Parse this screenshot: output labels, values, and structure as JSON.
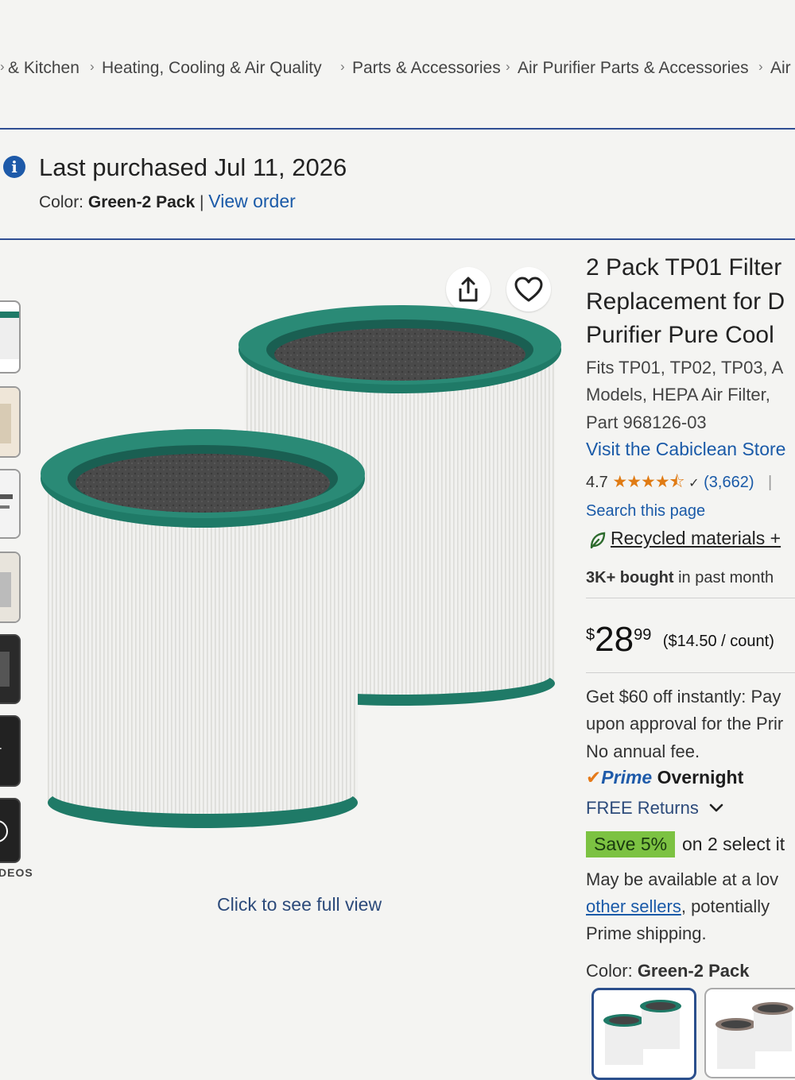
{
  "breadcrumb": [
    "& Kitchen",
    "Heating, Cooling & Air Quality",
    "Parts & Accessories",
    "Air Purifier Parts & Accessories",
    "Air"
  ],
  "last_purchased": {
    "title": "Last purchased Jul 11, 2026",
    "color_label": "Color:",
    "color_value": "Green-2 Pack",
    "separator": "|",
    "view_order": "View order"
  },
  "gallery": {
    "videos_label": "DEOS",
    "full_view": "Click to see full view"
  },
  "product": {
    "title_lines": [
      "2 Pack TP01 Filter",
      "Replacement for D",
      "Purifier Pure Cool"
    ],
    "subtitle_lines": [
      "Fits TP01, TP02, TP03, A",
      "Models, HEPA Air Filter,",
      "Part 968126-03"
    ],
    "store": "Visit the Cabiclean Store",
    "rating": "4.7",
    "stars": "★★★★⯪",
    "review_count": "(3,662)",
    "search_page": "Search this page",
    "recycled": "Recycled materials +",
    "bought_bold": "3K+ bought",
    "bought_rest": " in past month",
    "price": {
      "currency": "$",
      "whole": "28",
      "fraction": "99",
      "unit": "($14.50 / count)"
    },
    "promo_lines": [
      "Get $60 off instantly: Pay",
      "upon approval for the Prir",
      "No annual fee."
    ],
    "prime_label": "Prime",
    "prime_suffix": " Overnight",
    "free_returns": "FREE Returns",
    "save_badge": "Save 5%",
    "save_text": "on 2 select it",
    "avail_line_1": "May be available at a lov",
    "avail_link": "other sellers",
    "avail_line_2_rest": ", potentially",
    "avail_line_3": "Prime shipping.",
    "color_label": "Color:",
    "color_value": "Green-2 Pack"
  },
  "colors": {
    "filter_teal": "#1f7a67",
    "prime_blue": "#1e5aa9",
    "star_orange": "#e07b14",
    "save_green": "#7cc242",
    "link_blue": "#1a5aa8"
  }
}
